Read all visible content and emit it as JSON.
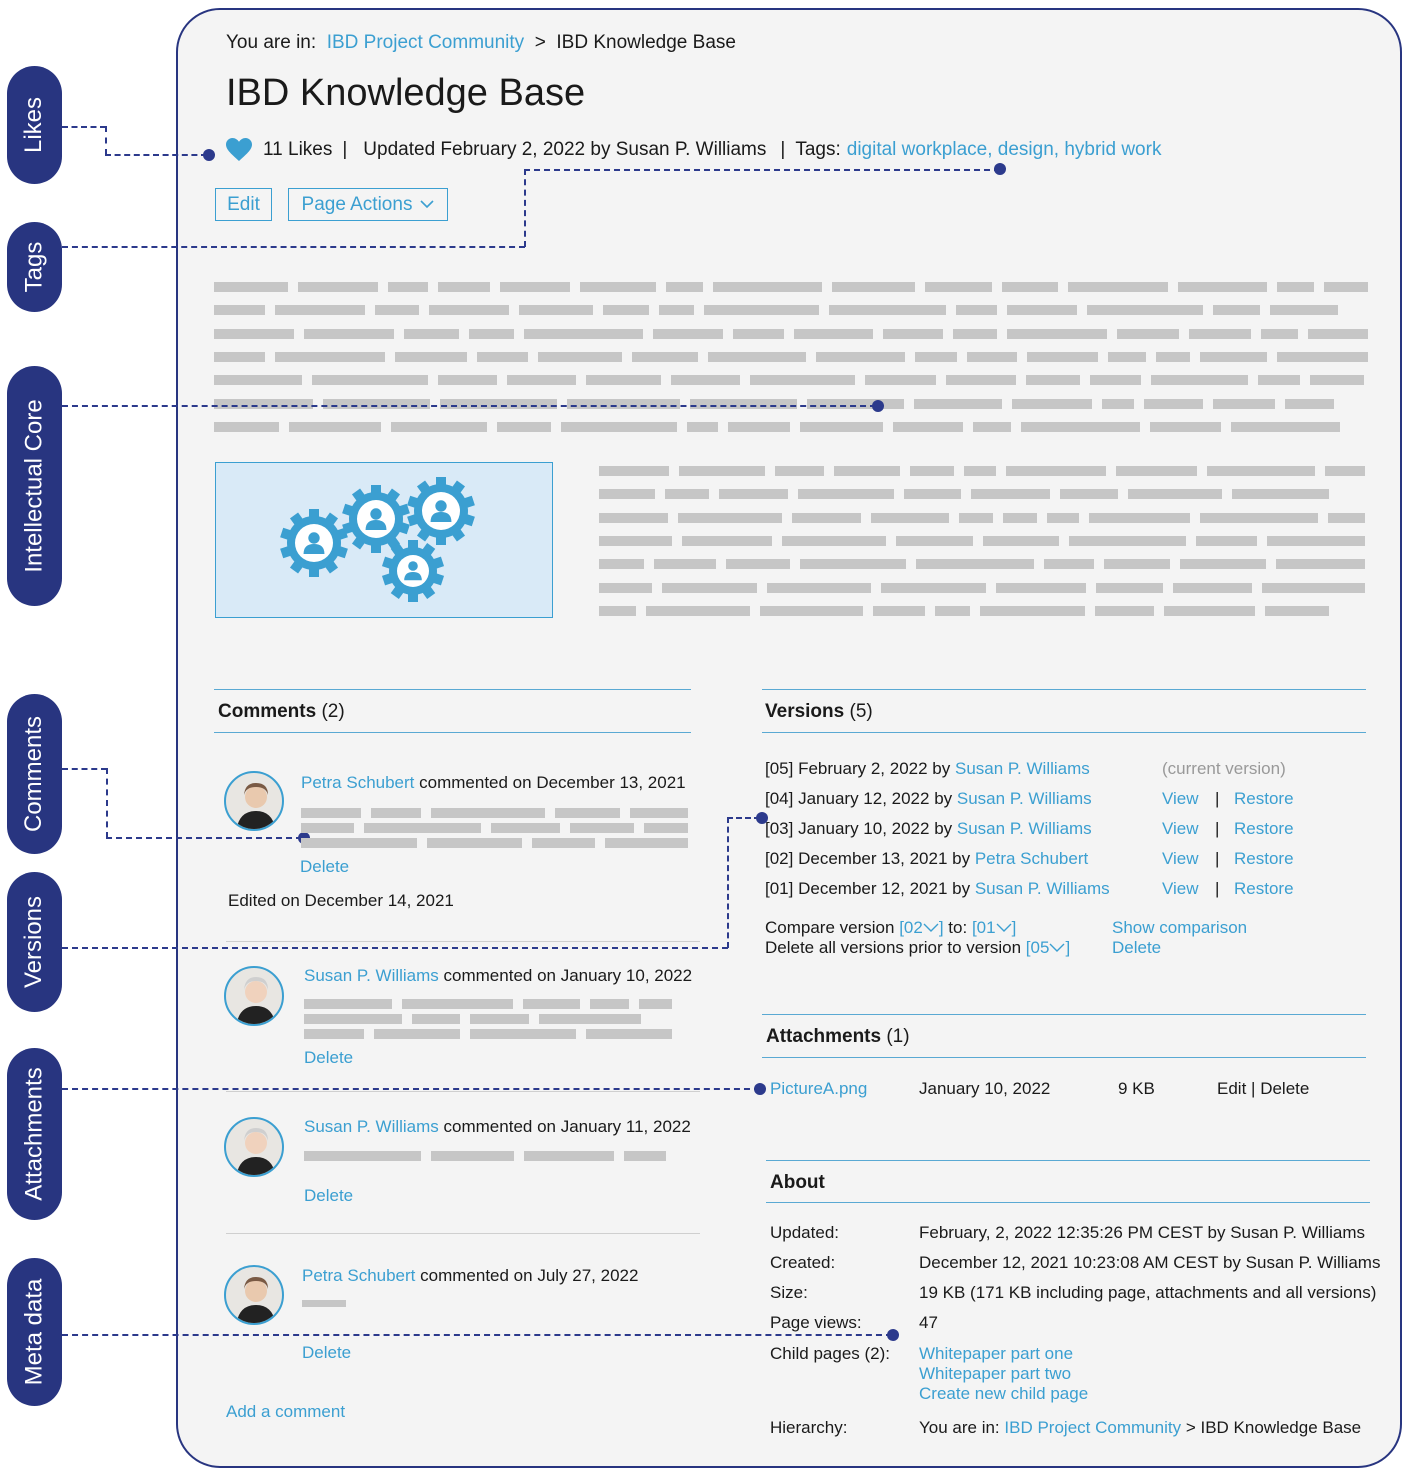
{
  "annotations": [
    {
      "id": "likes",
      "label": "Likes"
    },
    {
      "id": "tags",
      "label": "Tags"
    },
    {
      "id": "intellectual",
      "label": "Intellectual Core"
    },
    {
      "id": "comments",
      "label": "Comments"
    },
    {
      "id": "versions",
      "label": "Versions"
    },
    {
      "id": "attachments",
      "label": "Attachments"
    },
    {
      "id": "metadata",
      "label": "Meta data"
    }
  ],
  "breadcrumb": {
    "prefix": "You are in:",
    "parent": "IBD Project Community",
    "sep": ">",
    "current": "IBD Knowledge Base"
  },
  "page_title": "IBD Knowledge Base",
  "meta": {
    "likes": "11 Likes",
    "sep1": "|",
    "updated": "Updated February 2, 2022 by Susan P. Williams",
    "sep2": "|",
    "tags_label": "Tags:",
    "tags": "digital workplace, design, hybrid work"
  },
  "buttons": {
    "edit": "Edit",
    "page_actions": "Page Actions"
  },
  "comments": {
    "title": "Comments",
    "count": "(2)",
    "items": [
      {
        "author": "Petra Schubert",
        "action": "commented on December 13, 2021",
        "delete": "Delete",
        "edited": "Edited on December 14, 2021"
      },
      {
        "author": "Susan P. Williams",
        "action": "commented on January 10, 2022",
        "delete": "Delete"
      },
      {
        "author": "Susan P. Williams",
        "action": "commented on January 11, 2022",
        "delete": "Delete"
      },
      {
        "author": "Petra Schubert",
        "action": "commented on July 27, 2022",
        "delete": "Delete"
      }
    ],
    "add": "Add a comment"
  },
  "versions": {
    "title": "Versions",
    "count": "(5)",
    "rows": [
      {
        "num": "[05]",
        "date": "February 2, 2022 by",
        "author": "Susan P. Williams",
        "status": "(current version)"
      },
      {
        "num": "[04]",
        "date": "January 12, 2022 by",
        "author": "Susan P. Williams",
        "view": "View",
        "sep": "|",
        "restore": "Restore"
      },
      {
        "num": "[03]",
        "date": "January 10, 2022 by",
        "author": "Susan P. Williams",
        "view": "View",
        "sep": "|",
        "restore": "Restore"
      },
      {
        "num": "[02]",
        "date": "December 13, 2021 by",
        "author": "Petra Schubert",
        "view": "View",
        "sep": "|",
        "restore": "Restore"
      },
      {
        "num": "[01]",
        "date": "December 12, 2021 by",
        "author": "Susan P. Williams",
        "view": "View",
        "sep": "|",
        "restore": "Restore"
      }
    ],
    "compare_label": "Compare version",
    "compare_from": "[02",
    "compare_to_label": "to:",
    "compare_to": "[01",
    "show_comparison": "Show comparison",
    "delete_prior_label": "Delete all versions prior to version",
    "delete_prior_value": "[05",
    "delete": "Delete"
  },
  "attachments": {
    "title": "Attachments",
    "count": "(1)",
    "file": "PictureA.png",
    "date": "January 10, 2022",
    "size": "9 KB",
    "edit": "Edit",
    "sep": "|",
    "delete": "Delete"
  },
  "about": {
    "title": "About",
    "updated_label": "Updated:",
    "updated_value": "February, 2, 2022 12:35:26 PM CEST by Susan P. Williams",
    "created_label": "Created:",
    "created_value": "December 12, 2021 10:23:08 AM CEST by Susan P. Williams",
    "size_label": "Size:",
    "size_value": "19 KB (171 KB including page, attachments and all versions)",
    "views_label": "Page views:",
    "views_value": "47",
    "child_label": "Child pages (2):",
    "child_1": "Whitepaper part one",
    "child_2": "Whitepaper part two",
    "child_new": "Create new child page",
    "hierarchy_label": "Hierarchy:",
    "hierarchy_prefix": "You are in:",
    "hierarchy_parent": "IBD Project Community",
    "hierarchy_sep": ">",
    "hierarchy_current": "IBD Knowledge Base"
  },
  "colors": {
    "accent": "#3b9fd1",
    "annotation": "#283580",
    "placeholder": "#c6c6c6",
    "background": "#f4f4f4",
    "image_bg": "#d9eaf7"
  }
}
